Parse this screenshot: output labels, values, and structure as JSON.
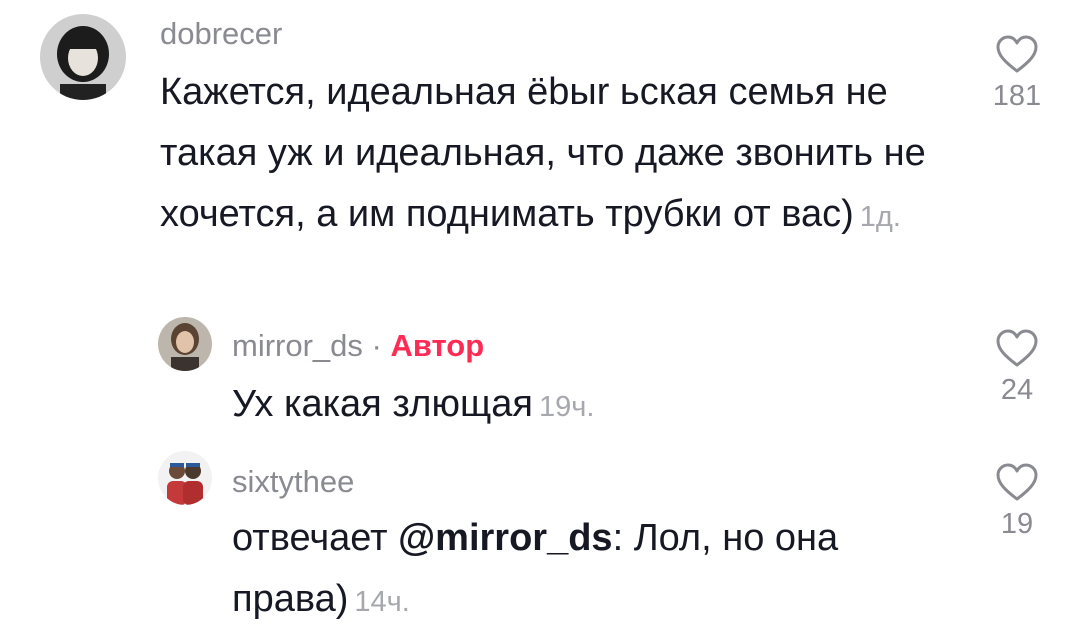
{
  "comments": [
    {
      "username": "dobrecer",
      "text": "Кажется, идеальная ёbыr ьская семья не такая уж и идеальная, что даже звонить не хочется, а им поднимать трубки от вас)",
      "time": "1д.",
      "likes": "181",
      "avatar_icon": "avatar-dark-hair-woman"
    },
    {
      "username": "mirror_ds",
      "separator": "·",
      "author_badge": "Автор",
      "text": "Ух какая злющая",
      "time": "19ч.",
      "likes": "24",
      "avatar_icon": "avatar-woman-photo"
    },
    {
      "username": "sixtythee",
      "reply_prefix": "отвечает",
      "mention": "@mirror_ds",
      "text": ": Лол, но она права)",
      "time": "14ч.",
      "likes": "19",
      "avatar_icon": "avatar-cartoon-duo"
    }
  ],
  "colors": {
    "text": "#161823",
    "muted": "#8a8b91",
    "author_accent": "#fe2c55"
  }
}
